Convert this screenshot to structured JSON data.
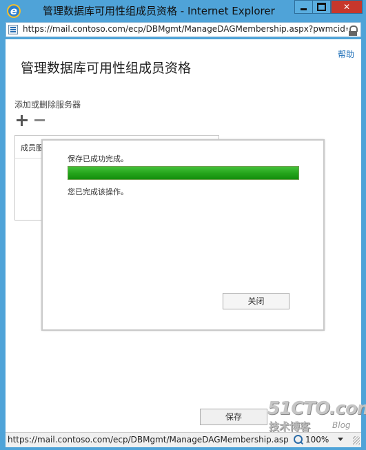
{
  "window": {
    "title": "管理数据库可用性组成员资格 - Internet Explorer"
  },
  "addressbar": {
    "url": "https://mail.contoso.com/ecp/DBMgmt/ManageDAGMembership.aspx?pwmcid="
  },
  "page": {
    "help_label": "帮助",
    "title": "管理数据库可用性组成员资格",
    "section_label": "添加或删除服务器",
    "table_header": "成员服"
  },
  "dialog": {
    "status_text": "保存已成功完成。",
    "progress": 1.0,
    "message": "您已完成该操作。",
    "close_label": "关闭"
  },
  "footer": {
    "save_label": "保存"
  },
  "statusbar": {
    "url": "https://mail.contoso.com/ecp/DBMgmt/ManageDAGMembership.asp",
    "zoom": "100%"
  },
  "watermark": {
    "main": "51CTO.com",
    "sub": "技术博客",
    "blog": "Blog"
  },
  "colors": {
    "frame": "#4fa3d8",
    "progress": "#25a51c",
    "link": "#1f6fb8"
  }
}
